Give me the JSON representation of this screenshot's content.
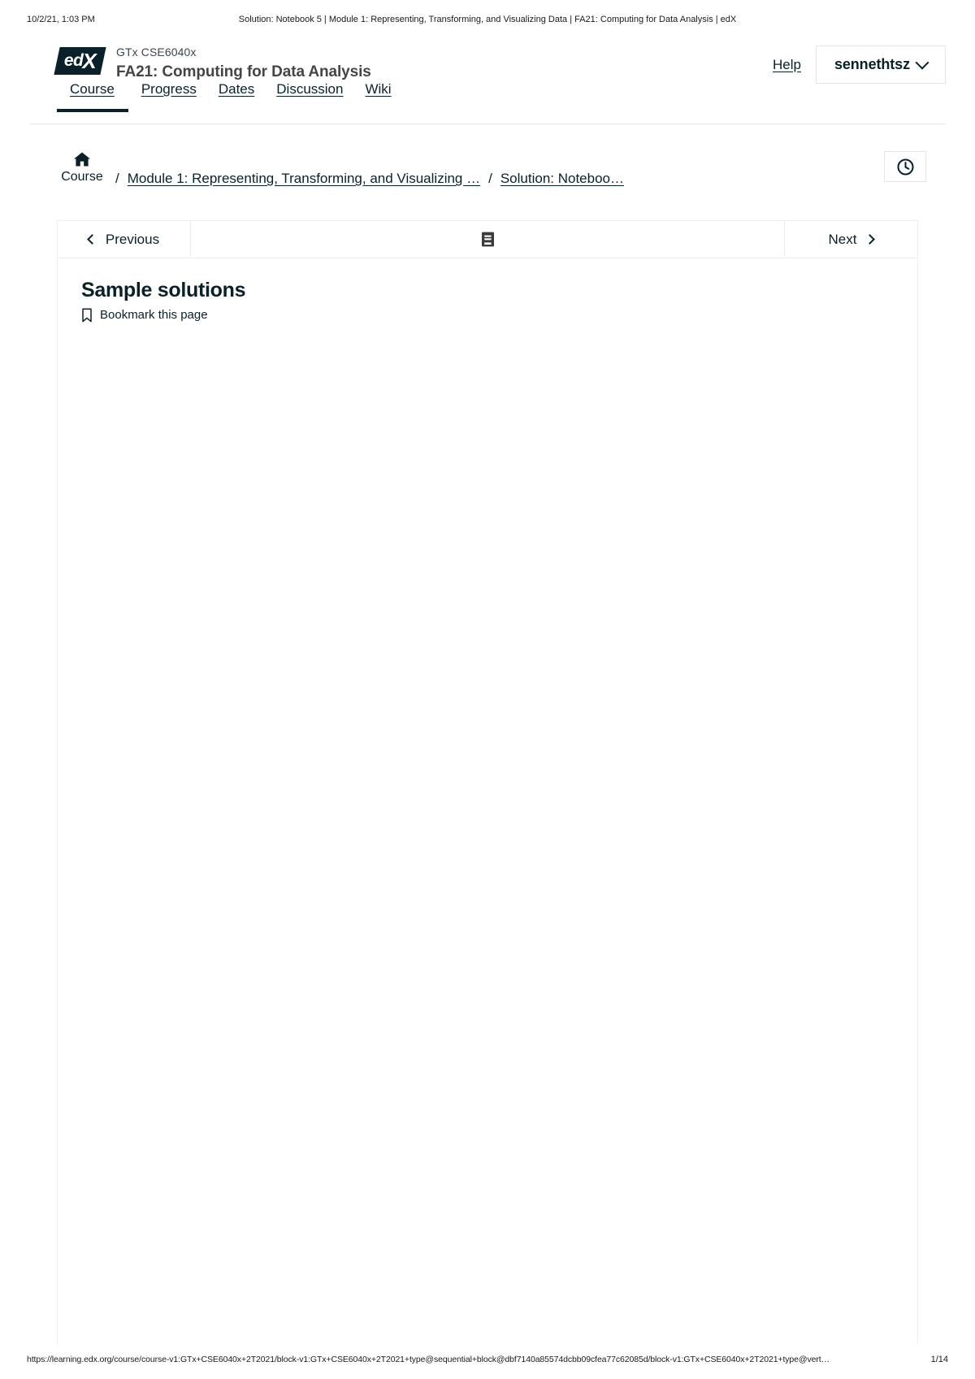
{
  "print": {
    "date": "10/2/21, 1:03 PM",
    "title": "Solution: Notebook 5 | Module 1: Representing, Transforming, and Visualizing Data | FA21: Computing for Data Analysis | edX",
    "footer_url": "https://learning.edx.org/course/course-v1:GTx+CSE6040x+2T2021/block-v1:GTx+CSE6040x+2T2021+type@sequential+block@dbf7140a85574dcbb09cfea77c62085d/block-v1:GTx+CSE6040x+2T2021+type@vert…",
    "page_number": "1/14"
  },
  "header": {
    "logo_text_ed": "ed",
    "logo_text_x": "X",
    "logo_alt": "edx-logo",
    "org": "GTx CSE6040x",
    "course_title": "FA21: Computing for Data Analysis",
    "help_label": "Help",
    "username": "sennethtsz",
    "chevron": "chevron-down-icon"
  },
  "nav_tabs": [
    {
      "label": "Course",
      "active": true
    },
    {
      "label": "Progress",
      "active": false
    },
    {
      "label": "Dates",
      "active": false
    },
    {
      "label": "Discussion",
      "active": false
    },
    {
      "label": "Wiki",
      "active": false
    }
  ],
  "breadcrumb": {
    "home_label": "Course",
    "home_icon": "home-icon",
    "separator": "/",
    "items": [
      {
        "label": "Module 1: Representing, Transforming, and Visualizing …"
      },
      {
        "label": "Solution: Noteboo…"
      }
    ],
    "clock_button_icon": "clock-icon"
  },
  "unit_nav": {
    "previous_label": "Previous",
    "next_label": "Next",
    "center_icon": "notebook-icon"
  },
  "unit": {
    "title": "Sample solutions",
    "bookmark_label": "Bookmark this page",
    "bookmark_icon": "bookmark-icon"
  },
  "colors": {
    "brand_dark": "#0a2129",
    "border": "#e3e5e8",
    "panel_border": "#ededed",
    "muted_text": "#3d454d"
  }
}
